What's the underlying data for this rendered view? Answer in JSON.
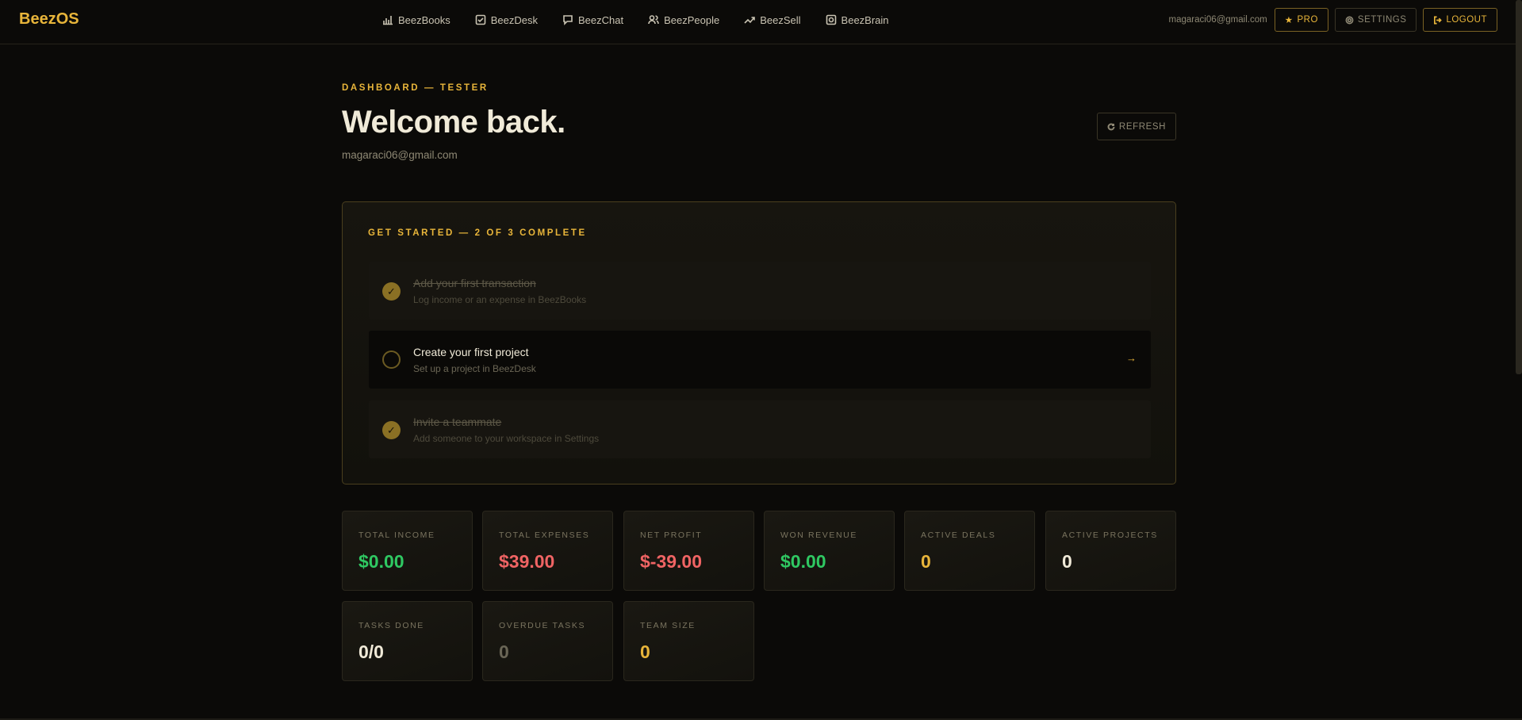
{
  "app": {
    "logo": "BeezOS"
  },
  "nav": [
    {
      "label": "BeezBooks",
      "icon": "bar-chart-icon"
    },
    {
      "label": "BeezDesk",
      "icon": "checkbox-icon"
    },
    {
      "label": "BeezChat",
      "icon": "chat-bubble-icon"
    },
    {
      "label": "BeezPeople",
      "icon": "people-icon"
    },
    {
      "label": "BeezSell",
      "icon": "trend-up-icon"
    },
    {
      "label": "BeezBrain",
      "icon": "brain-box-icon"
    }
  ],
  "header": {
    "email": "magaraci06@gmail.com",
    "pro_label": "PRO",
    "settings_label": "SETTINGS",
    "logout_label": "LOGOUT"
  },
  "page": {
    "eyebrow": "DASHBOARD — TESTER",
    "title": "Welcome back.",
    "email": "magaraci06@gmail.com",
    "refresh_label": "REFRESH"
  },
  "onboarding": {
    "title": "GET STARTED — 2 OF 3 COMPLETE",
    "steps": [
      {
        "title": "Add your first transaction",
        "desc": "Log income or an expense in BeezBooks",
        "done": true
      },
      {
        "title": "Create your first project",
        "desc": "Set up a project in BeezDesk",
        "done": false,
        "arrow": "→"
      },
      {
        "title": "Invite a teammate",
        "desc": "Add someone to your workspace in Settings",
        "done": true
      }
    ],
    "check_glyph": "✓"
  },
  "stats": [
    {
      "label": "TOTAL INCOME",
      "value": "$0.00",
      "color": "#2fc862"
    },
    {
      "label": "TOTAL EXPENSES",
      "value": "$39.00",
      "color": "#f06464"
    },
    {
      "label": "NET PROFIT",
      "value": "$-39.00",
      "color": "#f06464"
    },
    {
      "label": "WON REVENUE",
      "value": "$0.00",
      "color": "#2fc862"
    },
    {
      "label": "ACTIVE DEALS",
      "value": "0",
      "color": "#e8b53a"
    },
    {
      "label": "ACTIVE PROJECTS",
      "value": "0",
      "color": "#f0ead8"
    },
    {
      "label": "TASKS DONE",
      "value": "0/0",
      "color": "#f0ead8"
    },
    {
      "label": "OVERDUE TASKS",
      "value": "0",
      "color": "#6a6656"
    },
    {
      "label": "TEAM SIZE",
      "value": "0",
      "color": "#e8b53a"
    }
  ],
  "colors": {
    "accent": "#e8b53a",
    "background": "#0b0a08"
  }
}
